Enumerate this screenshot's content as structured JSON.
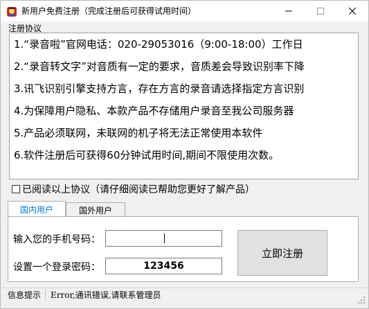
{
  "window": {
    "title": "新用户免费注册（完成注册后可获得试用时间）",
    "minimize": "—",
    "maximize": "☐",
    "close": "✕"
  },
  "agreement": {
    "group_label": "注册协议",
    "lines": [
      "1.“录音啦”官网电话：020-29053016（9:00-18:00）工作日",
      "2.“录音转文字”对音质有一定的要求，音质差会导致识别率下降",
      "3.讯飞识别引擎支持方言，存在方言的录音请选择指定方言识别",
      "4.为保障用户隐私、本款产品不存储用户录音至我公司服务器",
      "5.产品必须联网，未联网的机子将无法正常使用本软件",
      "6.软件注册后可获得60分钟试用时间,期间不限使用次数。"
    ],
    "checkbox_label": "已阅读以上协议（请仔细阅读已帮助您更好了解产品）"
  },
  "tabs": [
    {
      "label": "国内用户"
    },
    {
      "label": "国外用户"
    }
  ],
  "form": {
    "phone_label": "输入您的手机号码：",
    "phone_value": "",
    "password_label": "设置一个登录密码：",
    "password_value": "123456",
    "register_button": "立即注册"
  },
  "status": {
    "label": "信息提示",
    "message": "Error,通讯错误,请联系管理员"
  }
}
